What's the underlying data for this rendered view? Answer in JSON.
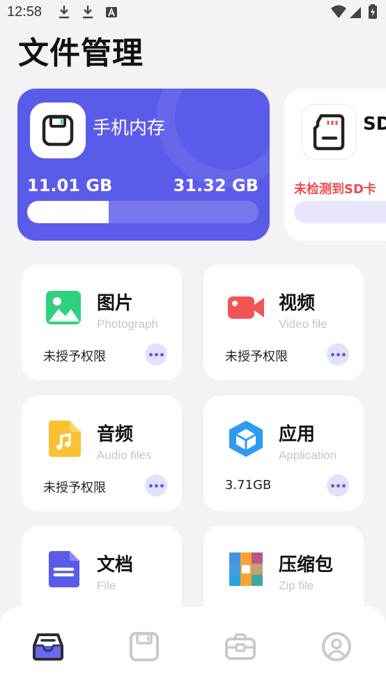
{
  "status_bar": {
    "time": "12:58",
    "left_icons": [
      "download-icon",
      "download-icon",
      "font-a-icon"
    ],
    "right_icons": [
      "wifi-icon",
      "signal-icon",
      "battery-charging-icon"
    ]
  },
  "page": {
    "title": "文件管理"
  },
  "storage": {
    "internal": {
      "name": "手机内存",
      "used": "11.01 GB",
      "total": "31.32 GB",
      "used_fraction": 0.352,
      "icon": "floppy-save-icon",
      "color": "#5b5bea"
    },
    "sd": {
      "name": "SD",
      "status": "未检测到SD卡",
      "icon": "sd-card-icon",
      "status_color": "#ef4b4b"
    }
  },
  "categories": [
    {
      "name": "图片",
      "subtitle": "Photograph",
      "status": "未授予权限",
      "icon": "image-icon",
      "color": "#2ed17c"
    },
    {
      "name": "视频",
      "subtitle": "Video file",
      "status": "未授予权限",
      "icon": "video-camera-icon",
      "color": "#f25454"
    },
    {
      "name": "音频",
      "subtitle": "Audio files",
      "status": "未授予权限",
      "icon": "music-file-icon",
      "color": "#f9c233"
    },
    {
      "name": "应用",
      "subtitle": "Application",
      "status": "3.71GB",
      "icon": "cube-app-icon",
      "color": "#2f9bf0"
    },
    {
      "name": "文档",
      "subtitle": "File",
      "status": "",
      "icon": "document-icon",
      "color": "#5b5bea"
    },
    {
      "name": "压缩包",
      "subtitle": "Zip file",
      "status": "",
      "icon": "zip-archive-icon",
      "color": "#f25454"
    }
  ],
  "bottom_nav": [
    {
      "id": "files",
      "icon": "inbox-tray-icon",
      "active": true
    },
    {
      "id": "storage",
      "icon": "floppy-save-icon",
      "active": false
    },
    {
      "id": "tools",
      "icon": "toolbox-icon",
      "active": false
    },
    {
      "id": "profile",
      "icon": "user-circle-icon",
      "active": false
    }
  ]
}
